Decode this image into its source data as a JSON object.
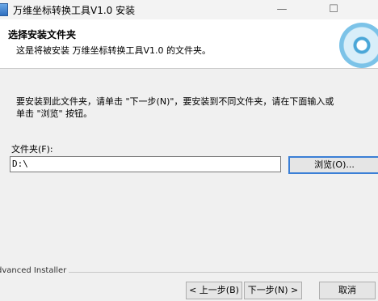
{
  "window": {
    "title": "万维坐标转换工具V1.0 安装",
    "minimize_glyph": "—",
    "maximize_glyph": "☐"
  },
  "header": {
    "title": "选择安装文件夹",
    "subtitle": "这是将被安装 万维坐标转换工具V1.0 的文件夹。"
  },
  "body": {
    "instruction_line1": "要安装到此文件夹，请单击 \"下一步(N)\"，要安装到不同文件夹，请在下面输入或",
    "instruction_line2": "单击 \"浏览\" 按钮。",
    "folder_label": "文件夹(F):",
    "folder_value": "D:\\",
    "browse_label": "浏览(O)..."
  },
  "footer": {
    "brand": "dvanced Installer",
    "back_label": "< 上一步(B)",
    "next_label": "下一步(N) >",
    "cancel_label": "取消"
  }
}
